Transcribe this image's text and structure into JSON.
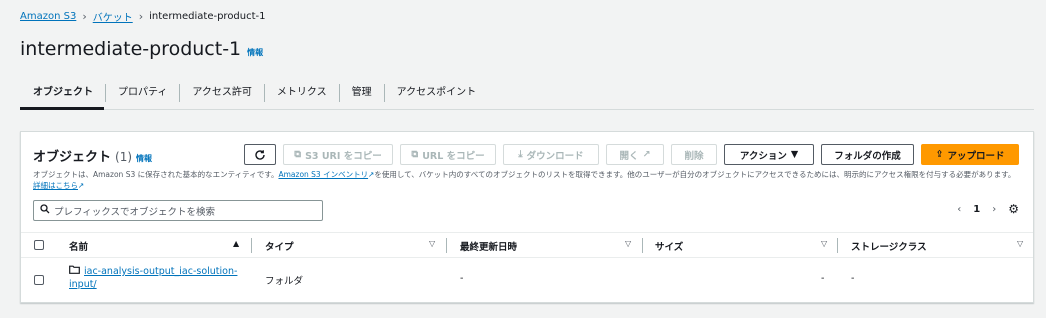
{
  "breadcrumb": {
    "items": [
      "Amazon S3",
      "バケット",
      "intermediate-product-1"
    ]
  },
  "header": {
    "title": "intermediate-product-1",
    "info_label": "情報"
  },
  "tabs": [
    {
      "label": "オブジェクト",
      "active": true
    },
    {
      "label": "プロパティ"
    },
    {
      "label": "アクセス許可"
    },
    {
      "label": "メトリクス"
    },
    {
      "label": "管理"
    },
    {
      "label": "アクセスポイント"
    }
  ],
  "objects_panel": {
    "title": "オブジェクト",
    "count": "(1)",
    "info_label": "情報",
    "toolbar": {
      "refresh_icon": "refresh-icon",
      "copy_s3_uri": "S3 URI をコピー",
      "copy_url": "URL をコピー",
      "download": "ダウンロード",
      "open": "開く",
      "delete": "削除",
      "actions": "アクション",
      "create_folder": "フォルダの作成",
      "upload": "アップロード"
    },
    "description": {
      "part1": "オブジェクトは、Amazon S3 に保存された基本的なエンティティです。",
      "inventory_link": "Amazon S3 インベントリ",
      "part2": "を使用して、バケット内のすべてのオブジェクトのリストを取得できます。他のユーザーが自分のオブジェクトにアクセスできるためには、明示的にアクセス権限を付与する必要があります。",
      "learn_more": "詳細はこちら"
    },
    "search": {
      "placeholder": "プレフィックスでオブジェクトを検索"
    },
    "pagination": {
      "page": "1"
    },
    "table": {
      "columns": [
        "名前",
        "タイプ",
        "最終更新日時",
        "サイズ",
        "ストレージクラス"
      ],
      "rows": [
        {
          "name_line1": "iac-analysis-output_iac-solution-",
          "name_line2": "input/",
          "type": "フォルダ",
          "last_modified": "-",
          "size": "-",
          "storage_class": "-"
        }
      ]
    }
  },
  "colors": {
    "link": "#0073bb",
    "primary": "#ff9900",
    "border": "#d5dbdb",
    "text": "#16191f"
  }
}
